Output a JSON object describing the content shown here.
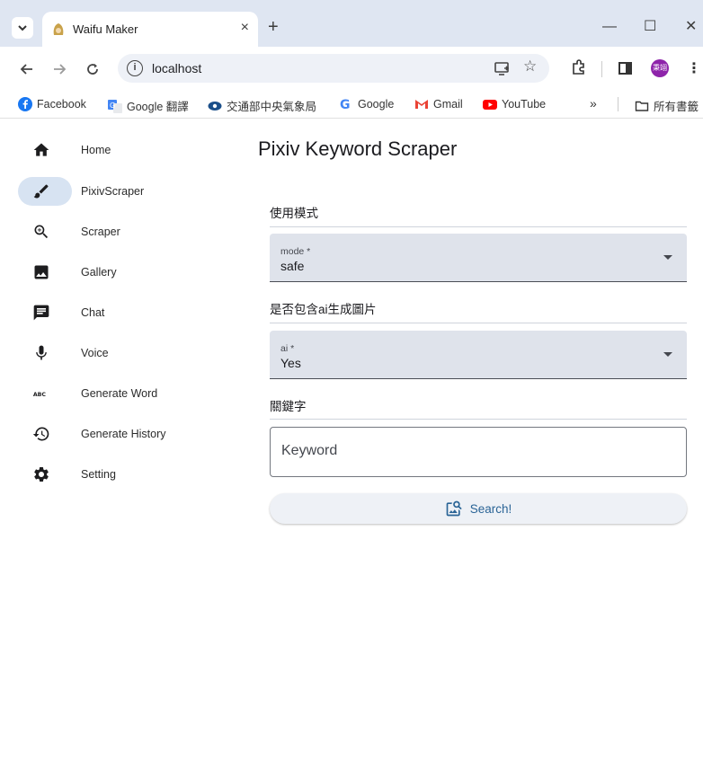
{
  "browser": {
    "tab": {
      "title": "Waifu Maker",
      "close_glyph": "×",
      "favicon": "waifu-favicon-icon"
    },
    "new_tab_glyph": "+",
    "window_controls": {
      "minimize": "—",
      "maximize": "☐",
      "close": "✕"
    },
    "omnibox": {
      "url": "localhost",
      "info_glyph": "i"
    },
    "avatar_text": "秉翊",
    "bookmarks": [
      {
        "label": "Facebook",
        "icon": "facebook-icon"
      },
      {
        "label": "Google 翻譯",
        "icon": "google-translate-icon"
      },
      {
        "label": "交通部中央氣象局",
        "icon": "cwb-icon"
      },
      {
        "label": "Google",
        "icon": "google-icon"
      },
      {
        "label": "Gmail",
        "icon": "gmail-icon"
      },
      {
        "label": "YouTube",
        "icon": "youtube-icon"
      }
    ],
    "bookmarks_overflow": "»",
    "all_bookmarks": "所有書籤"
  },
  "sidebar": {
    "items": [
      {
        "label": "Home",
        "icon": "home-icon"
      },
      {
        "label": "PixivScraper",
        "icon": "brush-icon",
        "active": true
      },
      {
        "label": "Scraper",
        "icon": "zoom-in-icon"
      },
      {
        "label": "Gallery",
        "icon": "image-icon"
      },
      {
        "label": "Chat",
        "icon": "chat-icon"
      },
      {
        "label": "Voice",
        "icon": "mic-icon"
      },
      {
        "label": "Generate Word",
        "icon": "abc-icon"
      },
      {
        "label": "Generate History",
        "icon": "history-icon"
      },
      {
        "label": "Setting",
        "icon": "gear-icon"
      }
    ]
  },
  "main": {
    "title": "Pixiv Keyword Scraper",
    "mode_section": {
      "heading": "使用模式",
      "field_label": "mode *",
      "value": "safe"
    },
    "ai_section": {
      "heading": "是否包含ai生成圖片",
      "field_label": "ai *",
      "value": "Yes"
    },
    "keyword_section": {
      "heading": "關鍵字",
      "placeholder": "Keyword",
      "value": ""
    },
    "search_button": {
      "label": "Search!",
      "icon": "image-search-icon"
    }
  },
  "colors": {
    "accent": "#2a6496",
    "active_pill": "#d7e3f2",
    "field_fill": "#dfe3eb",
    "tabstrip": "#dfe6f2"
  }
}
